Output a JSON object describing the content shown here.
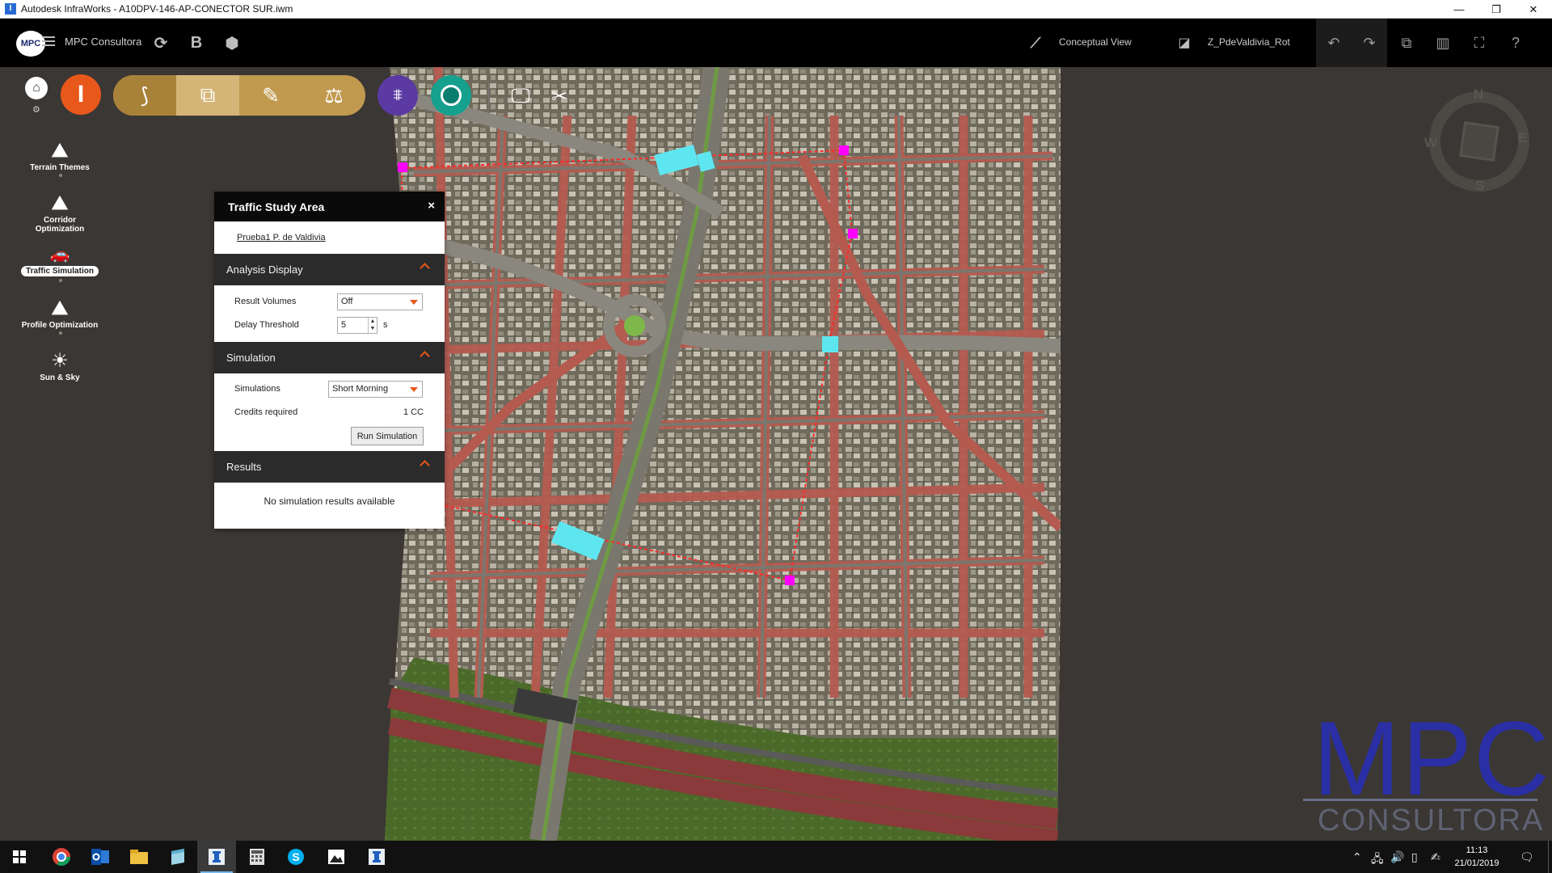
{
  "window": {
    "title": "Autodesk InfraWorks - A10DPV-146-AP-CONECTOR SUR.iwm",
    "app_icon": "I",
    "controls": [
      "—",
      "❐",
      "✕"
    ]
  },
  "header": {
    "logo": "MPC",
    "organization": "MPC Consultora",
    "sync_icon": "⟳",
    "bold_icon": "B",
    "cube_icon": "⬢",
    "view_mode": "Conceptual View",
    "proposal": "Z_PdeValdivia_Rot"
  },
  "leftbar": {
    "items": [
      {
        "label": "Terrain Themes",
        "icon": "⛰",
        "active": false
      },
      {
        "label": "Corridor Optimization",
        "icon": "⛰",
        "active": false
      },
      {
        "label": "Traffic Simulation",
        "icon": "🚗",
        "active": true
      },
      {
        "label": "Profile Optimization",
        "icon": "⛰",
        "active": false
      },
      {
        "label": "Sun & Sky",
        "icon": "☀",
        "active": false
      }
    ]
  },
  "toolbar": {
    "infraworks_logo": "I"
  },
  "panel": {
    "title": "Traffic Study Area",
    "close": "×",
    "link": "Prueba1 P. de Valdivia",
    "analysis": {
      "header": "Analysis Display",
      "result_volumes_label": "Result Volumes",
      "result_volumes_value": "Off",
      "delay_threshold_label": "Delay Threshold",
      "delay_threshold_value": "5",
      "delay_threshold_unit": "s"
    },
    "simulation": {
      "header": "Simulation",
      "simulations_label": "Simulations",
      "simulations_value": "Short Morning",
      "credits_label": "Credits required",
      "credits_value": "1 CC",
      "run_button": "Run Simulation"
    },
    "results": {
      "header": "Results",
      "empty_text": "No simulation results available"
    }
  },
  "compass": {
    "n": "N",
    "e": "E",
    "s": "S",
    "w": "W"
  },
  "watermark": {
    "big": "MPC",
    "small": "CONSULTORA"
  },
  "taskbar": {
    "time": "11:13",
    "date": "21/01/2019"
  },
  "colors": {
    "accent": "#e8581b",
    "tan": "#c19a4f",
    "purple": "#5b3aa3",
    "teal": "#16a08e",
    "study_area_node": "#ff00ff",
    "traffic_gate": "#5ee6f0"
  }
}
